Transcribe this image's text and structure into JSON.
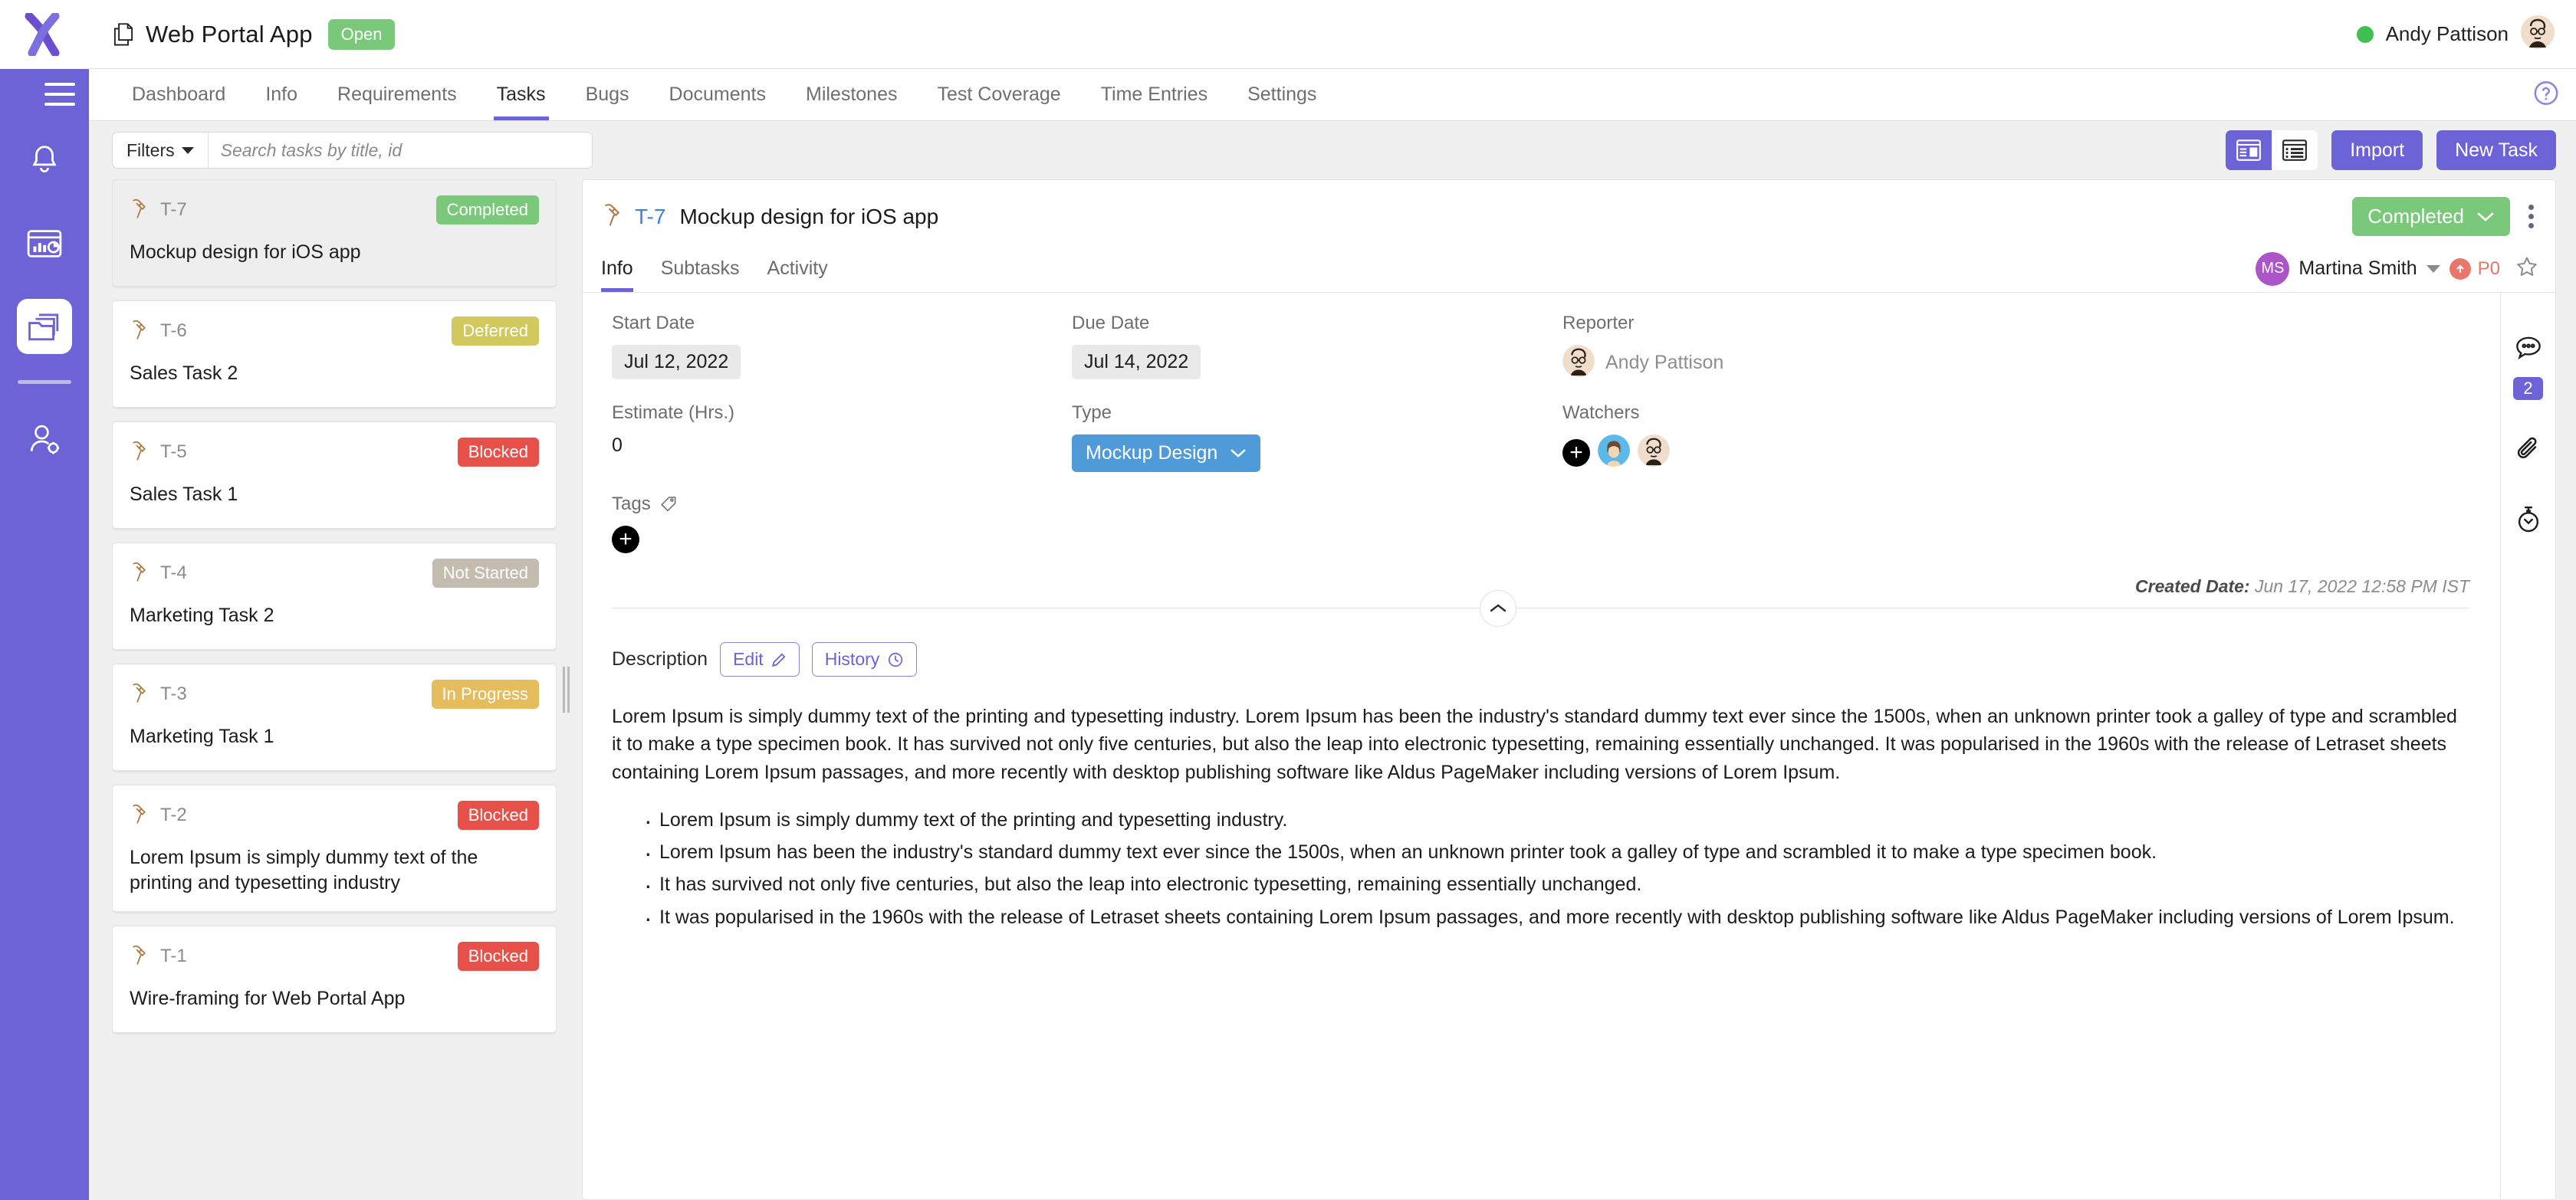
{
  "left_rail": {
    "logo_name": "x-logo",
    "hamburger_name": "hamburger-menu",
    "items": [
      {
        "icon": "bell-icon",
        "name": "notifications"
      },
      {
        "icon": "reports-icon",
        "name": "reports"
      },
      {
        "icon": "projects-folder-icon",
        "name": "projects",
        "active": true
      },
      {
        "icon": "user-settings-icon",
        "name": "user-settings"
      }
    ]
  },
  "topbar": {
    "project_icon": "documents-icon",
    "project_title": "Web Portal App",
    "project_status": "Open",
    "user_name": "Andy Pattison",
    "presence_color": "#3ec152"
  },
  "nav": {
    "tabs": [
      {
        "label": "Dashboard",
        "active": false
      },
      {
        "label": "Info",
        "active": false
      },
      {
        "label": "Requirements",
        "active": false
      },
      {
        "label": "Tasks",
        "active": true
      },
      {
        "label": "Bugs",
        "active": false
      },
      {
        "label": "Documents",
        "active": false
      },
      {
        "label": "Milestones",
        "active": false
      },
      {
        "label": "Test Coverage",
        "active": false
      },
      {
        "label": "Time Entries",
        "active": false
      },
      {
        "label": "Settings",
        "active": false
      }
    ],
    "help_icon": "help-circle-icon"
  },
  "toolbar": {
    "filters_label": "Filters",
    "search_placeholder": "Search tasks by title, id",
    "search_value": "",
    "view_split_icon": "split-view-icon",
    "view_list_icon": "list-view-icon",
    "import_label": "Import",
    "new_task_label": "New Task",
    "accent": "#6c63d6"
  },
  "task_list": [
    {
      "id": "T-7",
      "title": "Mockup design for iOS app",
      "status": "Completed",
      "status_color": "#7ac97a",
      "selected": true
    },
    {
      "id": "T-6",
      "title": "Sales Task 2",
      "status": "Deferred",
      "status_color": "#d1c95e",
      "selected": false
    },
    {
      "id": "T-5",
      "title": "Sales Task 1",
      "status": "Blocked",
      "status_color": "#e8504a",
      "selected": false
    },
    {
      "id": "T-4",
      "title": "Marketing Task 2",
      "status": "Not Started",
      "status_color": "#c3bdb0",
      "selected": false
    },
    {
      "id": "T-3",
      "title": "Marketing Task 1",
      "status": "In Progress",
      "status_color": "#e6bd5c",
      "selected": false
    },
    {
      "id": "T-2",
      "title": "Lorem Ipsum is simply dummy text of the printing and typesetting industry",
      "status": "Blocked",
      "status_color": "#e8504a",
      "selected": false
    },
    {
      "id": "T-1",
      "title": "Wire-framing for Web Portal App",
      "status": "Blocked",
      "status_color": "#e8504a",
      "selected": false
    }
  ],
  "detail": {
    "key": "T-7",
    "title": "Mockup design for iOS app",
    "status": "Completed",
    "status_color": "#7ac97a",
    "tabs": [
      {
        "label": "Info",
        "active": true
      },
      {
        "label": "Subtasks",
        "active": false
      },
      {
        "label": "Activity",
        "active": false
      }
    ],
    "assignee_initials": "MS",
    "assignee_name": "Martina Smith",
    "priority": "P0",
    "fields": {
      "start_date_label": "Start Date",
      "start_date_value": "Jul 12, 2022",
      "due_date_label": "Due Date",
      "due_date_value": "Jul 14, 2022",
      "reporter_label": "Reporter",
      "reporter_value": "Andy Pattison",
      "estimate_label": "Estimate (Hrs.)",
      "estimate_value": "0",
      "type_label": "Type",
      "type_value": "Mockup Design",
      "watchers_label": "Watchers",
      "tags_label": "Tags"
    },
    "created_date_label": "Created Date:",
    "created_date_value": "Jun 17, 2022 12:58 PM IST",
    "description_label": "Description",
    "edit_label": "Edit",
    "history_label": "History",
    "description_paragraph": "Lorem Ipsum is simply dummy text of the printing and typesetting industry. Lorem Ipsum has been the industry's standard dummy text ever since the 1500s, when an unknown printer took a galley of type and scrambled it to make a type specimen book. It has survived not only five centuries, but also the leap into electronic typesetting, remaining essentially unchanged. It was popularised in the 1960s with the release of Letraset sheets containing Lorem Ipsum passages, and more recently with desktop publishing software like Aldus PageMaker including versions of Lorem Ipsum.",
    "description_bullets": [
      "Lorem Ipsum is simply dummy text of the printing and typesetting industry.",
      "Lorem Ipsum has been the industry's standard dummy text ever since the 1500s, when an unknown printer took a galley of type and scrambled it to make a type specimen book.",
      "It has survived not only five centuries, but also the leap into electronic typesetting, remaining essentially unchanged.",
      "It was popularised in the 1960s with the release of Letraset sheets containing Lorem Ipsum passages, and more recently with desktop publishing software like Aldus PageMaker including versions of Lorem Ipsum."
    ],
    "rail": {
      "comments_icon": "comments-icon",
      "comments_count": "2",
      "attachments_icon": "paperclip-icon",
      "time_icon": "stopwatch-icon"
    }
  }
}
